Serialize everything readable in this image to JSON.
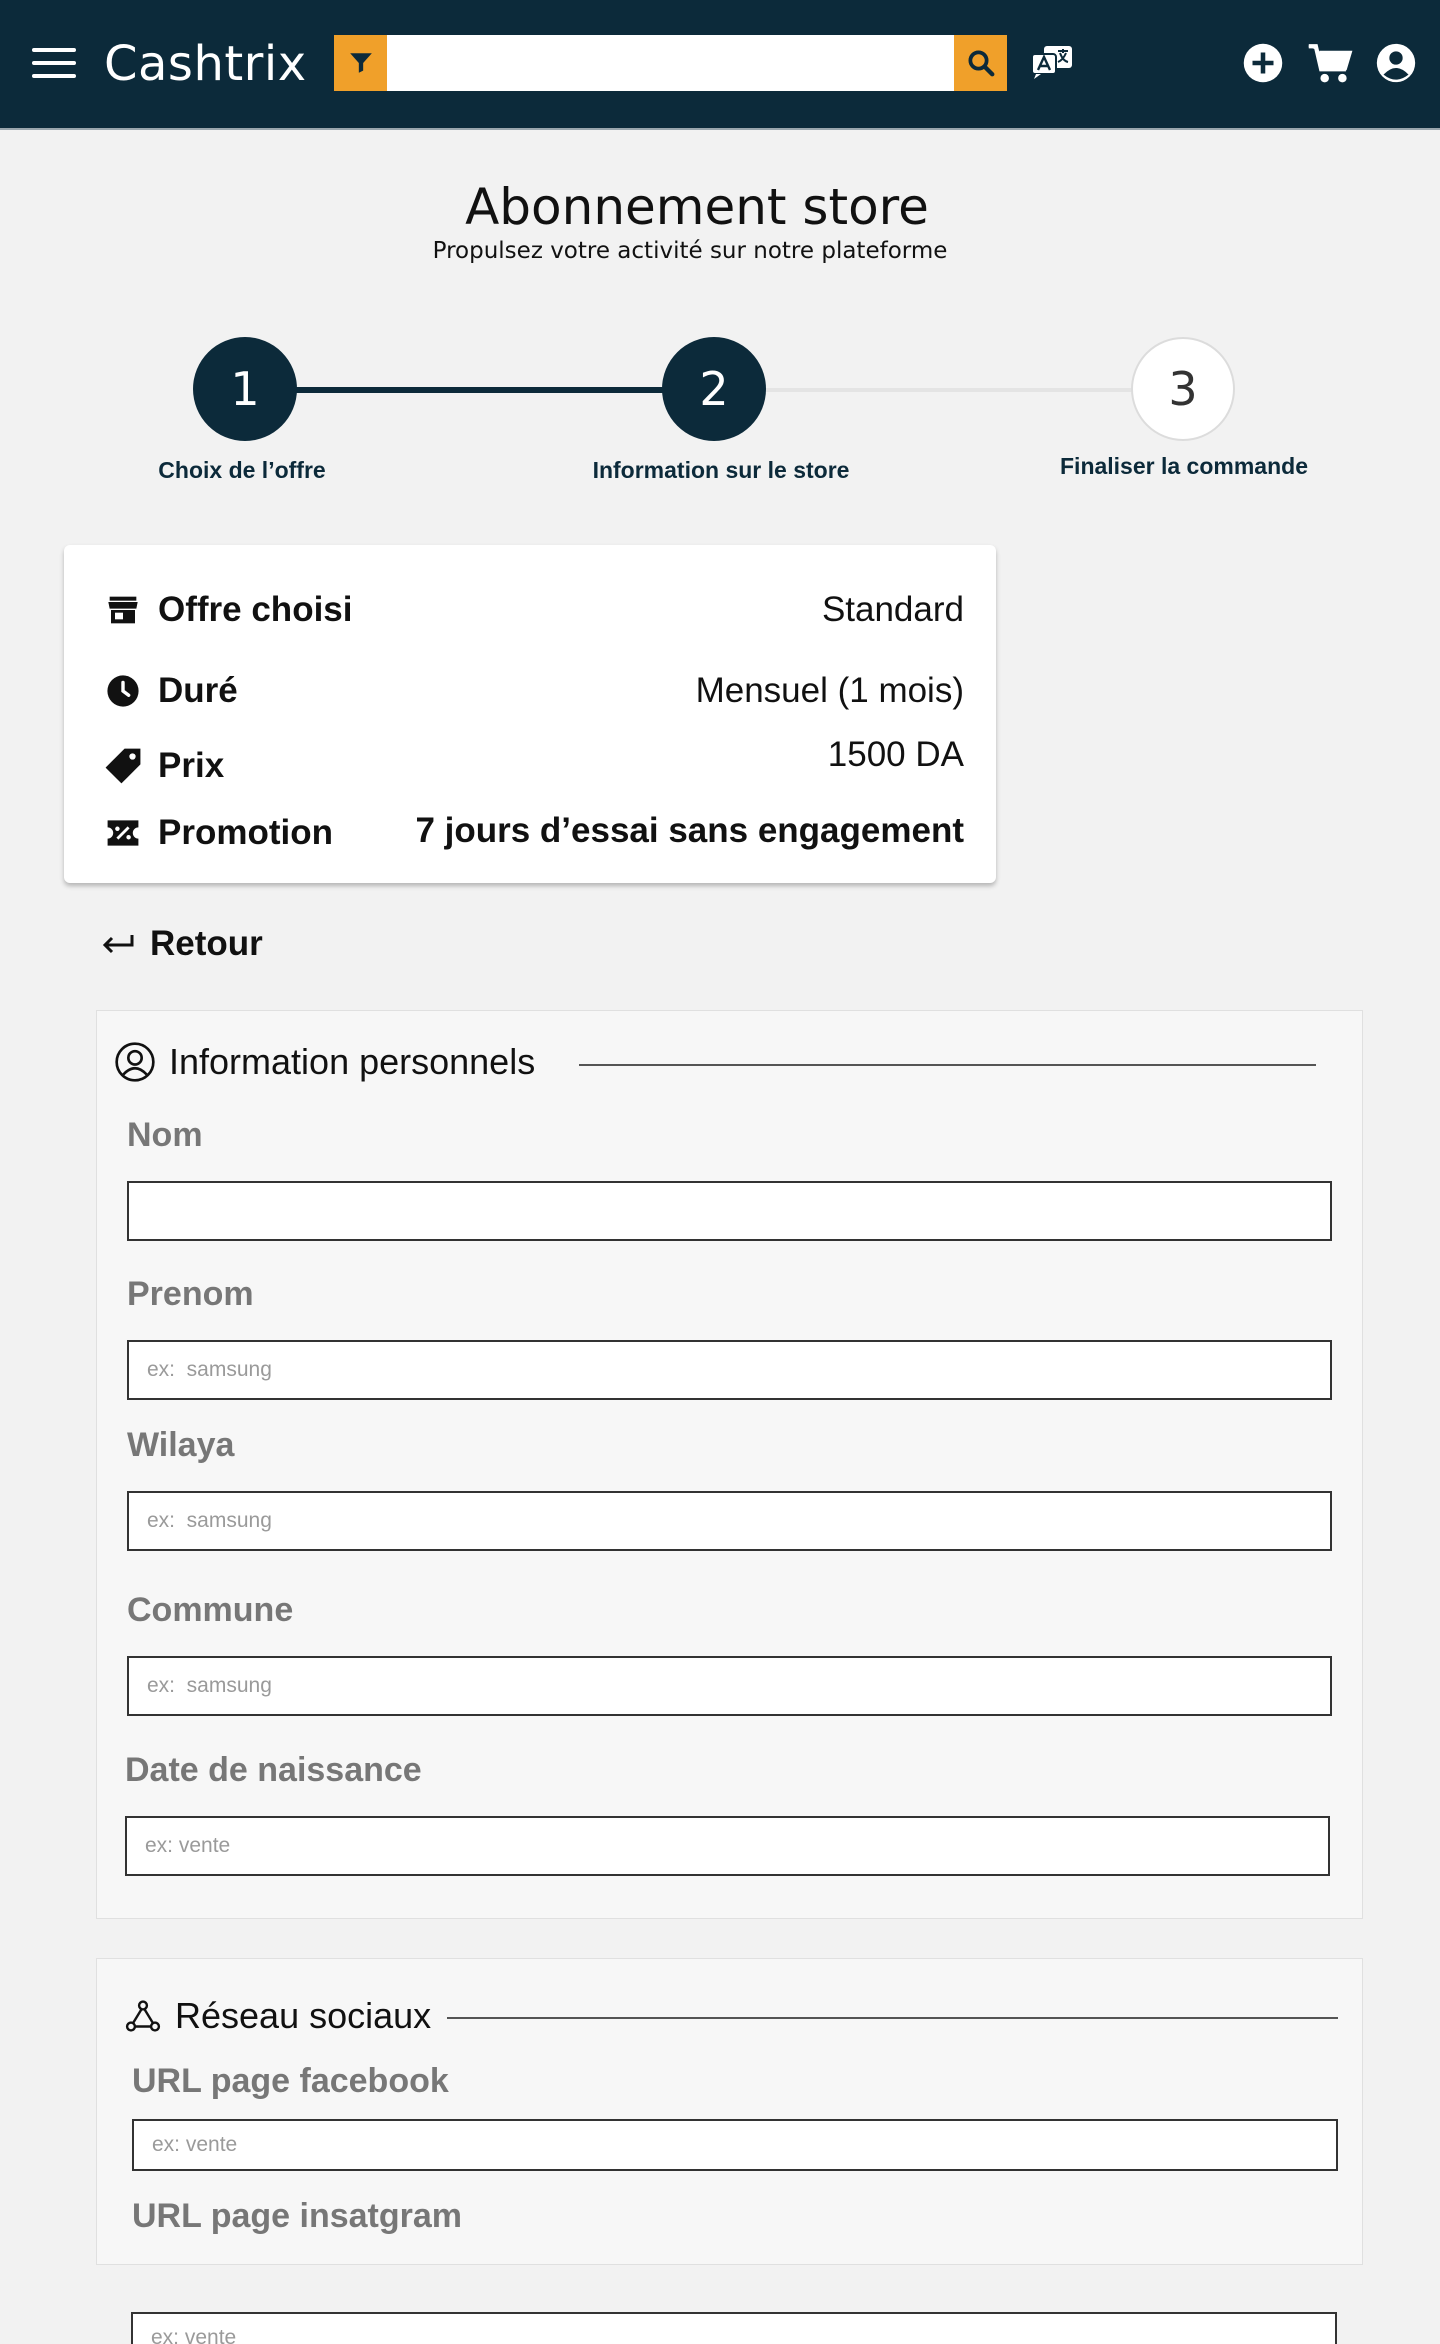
{
  "header": {
    "brand": "Cashtrix",
    "search_placeholder": "",
    "icons": [
      "menu-icon",
      "filter-icon",
      "search-icon",
      "translate-icon",
      "add-icon",
      "cart-icon",
      "account-icon"
    ],
    "colors": {
      "bar": "#0c2a3a",
      "accent": "#f0a02a"
    }
  },
  "page": {
    "title": "Abonnement store",
    "subtitle": "Propulsez votre activité sur notre plateforme"
  },
  "stepper": {
    "steps": [
      {
        "number": "1",
        "label": "Choix de l’offre",
        "state": "done"
      },
      {
        "number": "2",
        "label": "Information sur le store",
        "state": "active"
      },
      {
        "number": "3",
        "label": "Finaliser la commande",
        "state": "pending"
      }
    ]
  },
  "offer": {
    "rows": [
      {
        "icon": "store-icon",
        "label": "Offre choisi",
        "value": "Standard"
      },
      {
        "icon": "clock-icon",
        "label": "Duré",
        "value": "Mensuel (1 mois)"
      },
      {
        "icon": "tag-icon",
        "label": "Prix",
        "value": "1500 DA"
      },
      {
        "icon": "promotion-icon",
        "label": "Promotion",
        "value": "7 jours d’essai sans engagement"
      }
    ]
  },
  "back": {
    "label": "Retour"
  },
  "personal": {
    "title": "Information personnels",
    "fields": [
      {
        "label": "Nom",
        "placeholder": ""
      },
      {
        "label": "Prenom",
        "placeholder": "ex:  samsung"
      },
      {
        "label": "Wilaya",
        "placeholder": "ex:  samsung"
      },
      {
        "label": "Commune",
        "placeholder": "ex:  samsung"
      },
      {
        "label": "Date de naissance",
        "placeholder": "ex: vente"
      }
    ]
  },
  "social": {
    "title": "Réseau sociaux",
    "fields": [
      {
        "label": "URL page facebook",
        "placeholder": "ex: vente"
      },
      {
        "label": "URL page insatgram",
        "placeholder": "ex: vente"
      }
    ]
  }
}
